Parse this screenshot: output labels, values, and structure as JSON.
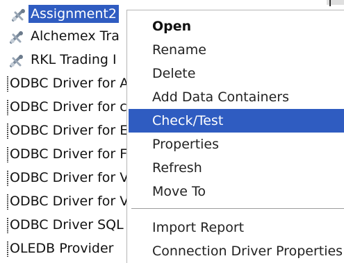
{
  "tree": {
    "items": [
      {
        "label": "Assignment2",
        "icon": "connection-icon",
        "selected": true
      },
      {
        "label": "Alchemex Tra",
        "icon": "connection-icon",
        "selected": false
      },
      {
        "label": "RKL Trading I",
        "icon": "connection-icon",
        "selected": false
      },
      {
        "label": "ODBC Driver for A",
        "icon": "driver-node",
        "selected": false
      },
      {
        "label": "ODBC Driver for c",
        "icon": "driver-node",
        "selected": false
      },
      {
        "label": "ODBC Driver for E",
        "icon": "driver-node",
        "selected": false
      },
      {
        "label": "ODBC Driver for F",
        "icon": "driver-node",
        "selected": false
      },
      {
        "label": "ODBC Driver for V",
        "icon": "driver-node",
        "selected": false
      },
      {
        "label": "ODBC Driver for V",
        "icon": "driver-node",
        "selected": false
      },
      {
        "label": "ODBC Driver SQL",
        "icon": "driver-node",
        "selected": false
      },
      {
        "label": "OLEDB Provider",
        "icon": "driver-node",
        "selected": false
      }
    ]
  },
  "menu": {
    "items": [
      {
        "label": "Open",
        "bold": true
      },
      {
        "label": "Rename"
      },
      {
        "label": "Delete"
      },
      {
        "label": "Add Data Containers"
      },
      {
        "label": "Check/Test",
        "highlighted": true
      },
      {
        "label": "Properties"
      },
      {
        "label": "Refresh"
      },
      {
        "label": "Move To"
      },
      {
        "label": "Import Report"
      },
      {
        "label": "Connection Driver Properties"
      }
    ]
  },
  "colors": {
    "selection": "#2f5cc1",
    "menu_background": "#ffffff",
    "text": "#222222"
  }
}
